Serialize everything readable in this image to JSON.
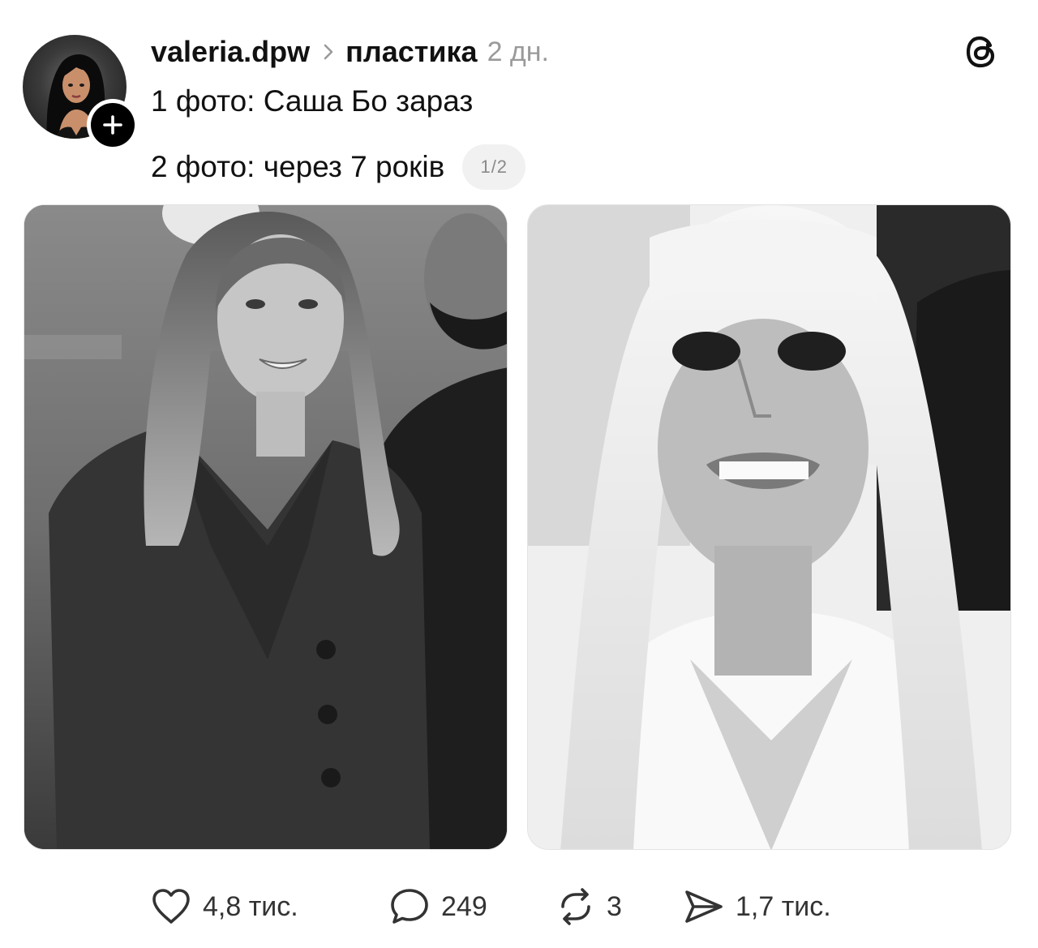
{
  "post": {
    "author": "valeria.dpw",
    "topic": "пластика",
    "time": "2 дн.",
    "caption_line1": "1 фото: Саша Бо зараз",
    "caption_line2": "2 фото: через 7 років",
    "media_counter": "1/2"
  },
  "media": [
    {
      "kind": "photo",
      "tone": "grayscale",
      "subject": "woman-in-blazer-with-man"
    },
    {
      "kind": "photo",
      "tone": "grayscale",
      "subject": "woman-with-long-platinum-hair"
    }
  ],
  "actions": {
    "likes": "4,8 тис.",
    "replies": "249",
    "reposts": "3",
    "shares": "1,7 тис."
  },
  "icons": {
    "follow": "plus-icon",
    "app": "threads-logo-icon",
    "like": "heart-icon",
    "reply": "speech-bubble-icon",
    "repost": "repost-icon",
    "share": "paper-plane-icon"
  },
  "colors": {
    "text": "#111111",
    "muted": "#9a9a9a",
    "counter_bg": "#f1f1f1",
    "background": "#ffffff"
  }
}
